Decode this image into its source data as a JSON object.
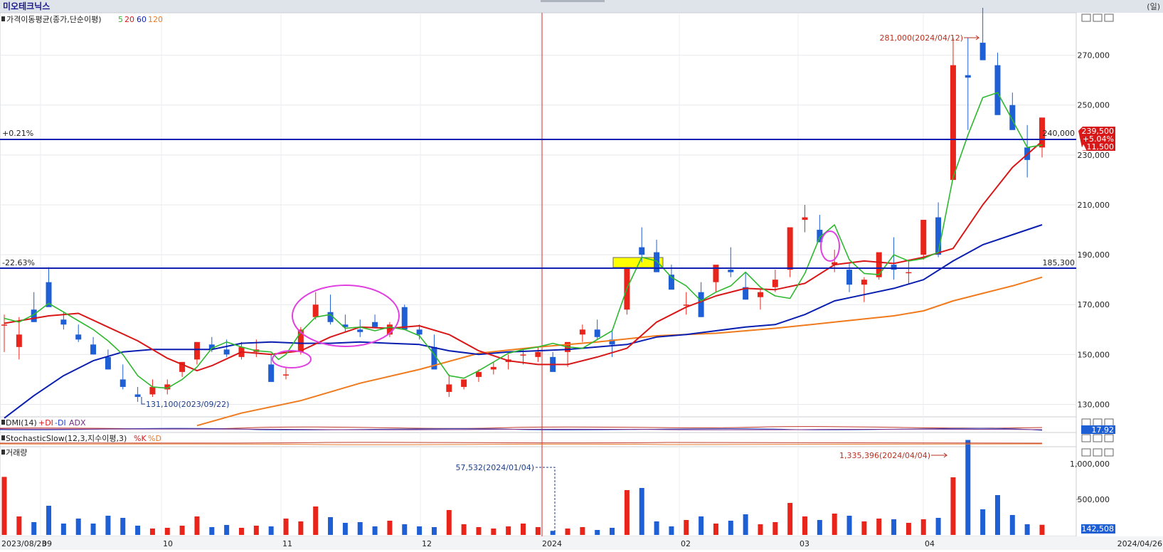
{
  "title": "미오테크닉스",
  "title_right": "(일)",
  "panels": {
    "price_label": "가격이동평균(종가,단순이평)",
    "ma_periods": [
      "5",
      "20",
      "60",
      "120"
    ],
    "dmi_label": "DMI(14)",
    "dmi_series": [
      "+DI",
      "-DI",
      "ADX"
    ],
    "dmi_value": "17.92",
    "stoch_label": "StochasticSlow(12,3,지수이평,3)",
    "stoch_series": [
      "%K",
      "%D"
    ],
    "volume_label": "거래량",
    "volume_value": "142,508"
  },
  "price_axis_labels": [
    "270,000",
    "250,000",
    "230,000",
    "210,000",
    "190,000",
    "170,000",
    "150,000",
    "130,000"
  ],
  "volume_axis_labels": [
    "1,000,000",
    "500,000"
  ],
  "x_axis_labels": [
    "2023/08/23",
    "09",
    "10",
    "11",
    "12",
    "2024",
    "02",
    "03",
    "04",
    "2024/04/26"
  ],
  "reference_lines": {
    "upper": {
      "pct": "+0.21%",
      "value": "240,000"
    },
    "lower": {
      "pct": "-22.63%",
      "value": "185,300"
    }
  },
  "annotations": {
    "high": "281,000(2024/04/12)",
    "low": "131,100(2023/09/22)",
    "volume_max": "1,335,396(2024/04/04)",
    "volume_mark": "57,532(2024/01/04)"
  },
  "current_price": {
    "price": "239,500",
    "pct": "+5.04%",
    "change": "▲11,500"
  },
  "colors": {
    "up": "#e8241b",
    "down": "#1f5fd6",
    "ma5": "#2eb82e",
    "ma20": "#d81818",
    "ma60": "#0a1fb0",
    "ma120": "#f07a1c",
    "ref_line": "#1020b0",
    "annotation": "#b8311f",
    "highlight_box": "#ffff00",
    "circle": "#e040e0"
  },
  "chart_data": {
    "type": "candlestick",
    "price_range": [
      125000,
      287000
    ],
    "ma5": [
      [
        0,
        164500
      ],
      [
        10,
        163000
      ],
      [
        20,
        166000
      ],
      [
        30,
        170500
      ],
      [
        40,
        167000
      ],
      [
        50,
        163500
      ],
      [
        60,
        160000
      ],
      [
        70,
        155500
      ],
      [
        80,
        150000
      ],
      [
        90,
        141500
      ],
      [
        100,
        137000
      ],
      [
        110,
        136500
      ],
      [
        120,
        140000
      ],
      [
        130,
        145000
      ],
      [
        140,
        152500
      ],
      [
        150,
        155000
      ],
      [
        160,
        153000
      ],
      [
        170,
        151500
      ],
      [
        180,
        151000
      ],
      [
        185,
        148000
      ],
      [
        190,
        150000
      ],
      [
        200,
        159000
      ],
      [
        210,
        165000
      ],
      [
        220,
        166000
      ],
      [
        230,
        160500
      ],
      [
        240,
        161000
      ],
      [
        250,
        159500
      ],
      [
        260,
        161000
      ],
      [
        270,
        160000
      ],
      [
        280,
        157500
      ],
      [
        290,
        150000
      ],
      [
        300,
        141500
      ],
      [
        310,
        140500
      ],
      [
        320,
        143500
      ],
      [
        330,
        147000
      ],
      [
        340,
        150500
      ],
      [
        350,
        152000
      ],
      [
        360,
        153000
      ],
      [
        370,
        154500
      ],
      [
        380,
        153000
      ],
      [
        390,
        152500
      ],
      [
        400,
        156000
      ],
      [
        410,
        159500
      ],
      [
        420,
        176500
      ],
      [
        430,
        189000
      ],
      [
        440,
        187500
      ],
      [
        450,
        181000
      ],
      [
        460,
        177500
      ],
      [
        470,
        171500
      ],
      [
        480,
        175000
      ],
      [
        490,
        177500
      ],
      [
        500,
        183000
      ],
      [
        510,
        177000
      ],
      [
        520,
        173500
      ],
      [
        530,
        172500
      ],
      [
        540,
        182500
      ],
      [
        550,
        197000
      ],
      [
        560,
        202000
      ],
      [
        570,
        188000
      ],
      [
        580,
        182500
      ],
      [
        590,
        182000
      ],
      [
        600,
        190000
      ],
      [
        610,
        187500
      ],
      [
        620,
        188500
      ],
      [
        630,
        191000
      ],
      [
        640,
        221000
      ],
      [
        650,
        238000
      ],
      [
        660,
        253000
      ],
      [
        670,
        255000
      ],
      [
        680,
        244000
      ],
      [
        690,
        233000
      ],
      [
        700,
        234000
      ]
    ],
    "ma20": [
      [
        0,
        162500
      ],
      [
        30,
        165500
      ],
      [
        50,
        166500
      ],
      [
        70,
        161000
      ],
      [
        90,
        155500
      ],
      [
        110,
        148500
      ],
      [
        130,
        143500
      ],
      [
        140,
        145500
      ],
      [
        160,
        151000
      ],
      [
        180,
        150000
      ],
      [
        200,
        151500
      ],
      [
        220,
        157000
      ],
      [
        240,
        161000
      ],
      [
        260,
        160500
      ],
      [
        280,
        161500
      ],
      [
        300,
        158000
      ],
      [
        320,
        151500
      ],
      [
        340,
        147500
      ],
      [
        360,
        146000
      ],
      [
        380,
        146000
      ],
      [
        400,
        149000
      ],
      [
        420,
        152500
      ],
      [
        440,
        163000
      ],
      [
        460,
        169000
      ],
      [
        480,
        173500
      ],
      [
        500,
        176500
      ],
      [
        520,
        176000
      ],
      [
        540,
        178500
      ],
      [
        560,
        186000
      ],
      [
        580,
        187500
      ],
      [
        600,
        186500
      ],
      [
        620,
        189000
      ],
      [
        640,
        192500
      ],
      [
        660,
        210000
      ],
      [
        680,
        225000
      ],
      [
        700,
        235500
      ]
    ],
    "ma60": [
      [
        0,
        124500
      ],
      [
        20,
        133500
      ],
      [
        40,
        141500
      ],
      [
        60,
        147500
      ],
      [
        80,
        151000
      ],
      [
        100,
        152000
      ],
      [
        120,
        152000
      ],
      [
        140,
        152000
      ],
      [
        160,
        154500
      ],
      [
        180,
        155000
      ],
      [
        200,
        154500
      ],
      [
        220,
        154500
      ],
      [
        240,
        155000
      ],
      [
        260,
        154500
      ],
      [
        280,
        154000
      ],
      [
        300,
        151500
      ],
      [
        320,
        150000
      ],
      [
        340,
        151000
      ],
      [
        360,
        151500
      ],
      [
        380,
        152000
      ],
      [
        400,
        153000
      ],
      [
        420,
        154000
      ],
      [
        440,
        157000
      ],
      [
        460,
        158000
      ],
      [
        480,
        159500
      ],
      [
        500,
        161000
      ],
      [
        520,
        162000
      ],
      [
        540,
        166000
      ],
      [
        560,
        171500
      ],
      [
        580,
        174000
      ],
      [
        600,
        176500
      ],
      [
        620,
        180000
      ],
      [
        640,
        187500
      ],
      [
        660,
        194000
      ],
      [
        680,
        198000
      ],
      [
        700,
        202000
      ]
    ],
    "ma120": [
      [
        130,
        121500
      ],
      [
        160,
        126500
      ],
      [
        200,
        131500
      ],
      [
        240,
        138500
      ],
      [
        280,
        144000
      ],
      [
        320,
        150500
      ],
      [
        360,
        153000
      ],
      [
        400,
        155000
      ],
      [
        440,
        157500
      ],
      [
        480,
        158500
      ],
      [
        520,
        160500
      ],
      [
        560,
        163000
      ],
      [
        600,
        165500
      ],
      [
        620,
        167500
      ],
      [
        640,
        171500
      ],
      [
        660,
        174500
      ],
      [
        680,
        177500
      ],
      [
        700,
        181000
      ]
    ],
    "candles": [
      [
        0,
        162,
        166,
        151,
        162
      ],
      [
        10,
        153,
        165,
        148,
        158
      ],
      [
        20,
        168,
        175,
        163,
        163
      ],
      [
        30,
        179,
        185,
        176,
        169
      ],
      [
        40,
        164,
        167,
        160,
        162
      ],
      [
        50,
        158,
        162,
        155,
        156
      ],
      [
        60,
        154,
        157,
        150,
        150
      ],
      [
        70,
        149,
        152,
        144,
        144
      ],
      [
        80,
        140,
        146,
        136,
        137
      ],
      [
        90,
        134,
        137,
        131,
        133
      ],
      [
        100,
        134,
        140,
        133,
        137
      ],
      [
        110,
        136,
        140,
        134,
        138
      ],
      [
        120,
        143,
        147,
        141,
        147
      ],
      [
        130,
        148,
        155,
        146,
        155
      ],
      [
        140,
        154,
        157,
        151,
        152
      ],
      [
        150,
        152,
        156,
        149,
        150
      ],
      [
        160,
        149,
        155,
        148,
        153
      ],
      [
        170,
        151,
        156,
        149,
        152
      ],
      [
        180,
        146,
        150,
        142,
        139
      ],
      [
        190,
        142,
        145,
        140,
        142
      ],
      [
        200,
        151,
        161,
        150,
        160
      ],
      [
        210,
        165,
        175,
        164,
        170
      ],
      [
        220,
        167,
        174,
        162,
        163
      ],
      [
        230,
        162,
        166,
        159,
        161
      ],
      [
        240,
        160,
        164,
        157,
        159
      ],
      [
        250,
        163,
        166,
        161,
        161
      ],
      [
        260,
        158,
        163,
        157,
        162
      ],
      [
        270,
        169,
        170,
        160,
        160
      ],
      [
        280,
        160,
        162,
        156,
        158
      ],
      [
        290,
        153,
        158,
        149,
        144
      ],
      [
        300,
        135,
        142,
        133,
        138
      ],
      [
        310,
        137,
        139,
        136,
        140
      ],
      [
        320,
        141,
        144,
        139,
        143
      ],
      [
        330,
        144,
        147,
        142,
        145
      ],
      [
        340,
        147,
        150,
        144,
        148
      ],
      [
        350,
        150,
        152,
        146,
        150
      ],
      [
        360,
        149,
        153,
        147,
        151
      ],
      [
        370,
        149,
        151,
        146,
        143
      ],
      [
        380,
        151,
        154,
        145,
        155
      ],
      [
        390,
        158,
        162,
        155,
        160
      ],
      [
        400,
        160,
        164,
        156,
        157
      ],
      [
        410,
        156,
        160,
        149,
        154
      ],
      [
        420,
        168,
        184,
        166,
        185
      ],
      [
        430,
        193,
        201,
        187,
        190
      ],
      [
        440,
        191,
        196,
        183,
        183
      ],
      [
        450,
        182,
        186,
        177,
        176
      ],
      [
        460,
        170,
        175,
        166,
        170
      ],
      [
        470,
        175,
        179,
        165,
        165
      ],
      [
        480,
        179,
        184,
        175,
        186
      ],
      [
        490,
        184,
        193,
        181,
        183
      ],
      [
        500,
        177,
        183,
        172,
        172
      ],
      [
        510,
        173,
        176,
        168,
        175
      ],
      [
        520,
        177,
        184,
        175,
        180
      ],
      [
        530,
        184,
        199,
        181,
        201
      ],
      [
        540,
        204,
        210,
        199,
        205
      ],
      [
        550,
        200,
        206,
        195,
        195
      ],
      [
        560,
        186,
        192,
        183,
        187
      ],
      [
        570,
        184,
        187,
        175,
        178
      ],
      [
        580,
        178,
        181,
        171,
        180
      ],
      [
        590,
        181,
        190,
        180,
        191
      ],
      [
        600,
        186,
        197,
        180,
        184
      ],
      [
        610,
        183,
        188,
        178,
        183
      ],
      [
        620,
        190,
        203,
        188,
        204
      ],
      [
        630,
        205,
        211,
        189,
        190
      ],
      [
        640,
        220,
        277,
        228,
        266
      ],
      [
        650,
        262,
        277,
        240,
        261
      ],
      [
        660,
        275,
        289,
        273,
        268
      ],
      [
        670,
        266,
        271,
        252,
        246
      ],
      [
        680,
        250,
        255,
        245,
        240
      ],
      [
        690,
        233,
        242,
        221,
        228
      ],
      [
        700,
        233,
        242,
        229,
        245
      ]
    ],
    "volume": [
      [
        0,
        816
      ],
      [
        10,
        260
      ],
      [
        20,
        180
      ],
      [
        30,
        410
      ],
      [
        40,
        160
      ],
      [
        50,
        230
      ],
      [
        60,
        160
      ],
      [
        70,
        270
      ],
      [
        80,
        240
      ],
      [
        90,
        130
      ],
      [
        100,
        90
      ],
      [
        110,
        100
      ],
      [
        120,
        130
      ],
      [
        130,
        260
      ],
      [
        140,
        110
      ],
      [
        150,
        140
      ],
      [
        160,
        100
      ],
      [
        170,
        130
      ],
      [
        180,
        120
      ],
      [
        190,
        230
      ],
      [
        200,
        190
      ],
      [
        210,
        400
      ],
      [
        220,
        250
      ],
      [
        230,
        170
      ],
      [
        240,
        180
      ],
      [
        250,
        120
      ],
      [
        260,
        200
      ],
      [
        270,
        150
      ],
      [
        280,
        120
      ],
      [
        290,
        110
      ],
      [
        300,
        350
      ],
      [
        310,
        150
      ],
      [
        320,
        110
      ],
      [
        330,
        90
      ],
      [
        340,
        120
      ],
      [
        350,
        160
      ],
      [
        360,
        110
      ],
      [
        370,
        57.5
      ],
      [
        380,
        90
      ],
      [
        390,
        110
      ],
      [
        400,
        70
      ],
      [
        410,
        100
      ],
      [
        420,
        630
      ],
      [
        430,
        660
      ],
      [
        440,
        190
      ],
      [
        450,
        120
      ],
      [
        460,
        210
      ],
      [
        470,
        260
      ],
      [
        480,
        160
      ],
      [
        490,
        200
      ],
      [
        500,
        290
      ],
      [
        510,
        150
      ],
      [
        520,
        180
      ],
      [
        530,
        450
      ],
      [
        540,
        260
      ],
      [
        550,
        210
      ],
      [
        560,
        300
      ],
      [
        570,
        270
      ],
      [
        580,
        190
      ],
      [
        590,
        230
      ],
      [
        600,
        220
      ],
      [
        610,
        170
      ],
      [
        620,
        220
      ],
      [
        630,
        240
      ],
      [
        640,
        810
      ],
      [
        650,
        1335
      ],
      [
        660,
        360
      ],
      [
        670,
        560
      ],
      [
        680,
        280
      ],
      [
        690,
        150
      ],
      [
        700,
        142.5
      ]
    ],
    "volume_unit": "thousands"
  }
}
